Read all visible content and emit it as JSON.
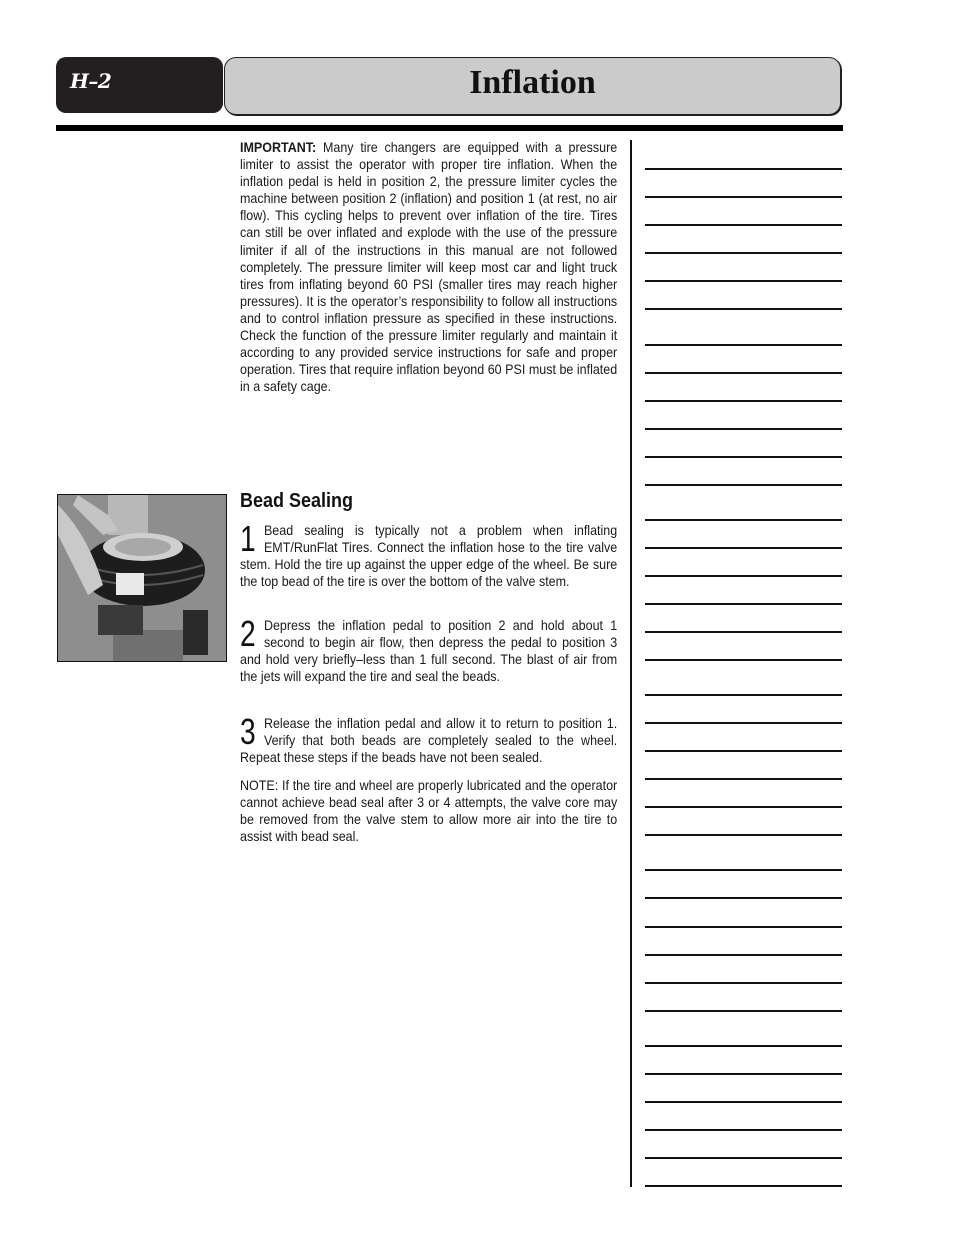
{
  "header": {
    "section_code": "H–2",
    "title": "Inflation"
  },
  "important": {
    "label": "IMPORTANT:",
    "text": " Many tire changers are equipped with a pressure limiter to assist the operator with proper tire inflation. When the inflation pedal is held in position 2, the pressure limiter cycles the machine between position 2 (inflation) and position 1 (at rest, no air flow). This cycling helps to prevent over inflation of the tire. Tires can still be over inflated and explode with the use of the pressure limiter if all of the instructions in this manual are not followed completely. The pressure limiter will keep most car and light truck tires from inflating beyond 60 PSI (smaller tires may reach higher pressures). It is the operator’s responsibility to follow all instructions and to control inflation pressure as specified in these instructions. Check the function of the pressure limiter regularly and maintain it according to any provided service instructions for safe and proper operation. Tires that require inflation beyond 60 PSI must be inflated in a safety cage."
  },
  "bead_sealing": {
    "heading": "Bead Sealing",
    "photo_alt": "Hands holding a tire and wheel against a tire changer",
    "steps": [
      {
        "number": "1",
        "text": "Bead sealing is typically not a problem when inflating EMT/RunFlat Tires. Connect the inflation hose to the tire valve stem. Hold the tire up against the upper edge of the wheel. Be sure the top bead of the tire is over the bottom of the valve stem."
      },
      {
        "number": "2",
        "text": "Depress the inflation pedal to position 2 and hold about 1 second to begin air flow, then depress the pedal to position 3 and hold very briefly–less than 1 full second. The blast of air from the jets will expand the tire and seal the beads."
      },
      {
        "number": "3",
        "text": "Release the inflation pedal and allow it to return to position 1. Verify that both beads are completely sealed to the wheel. Repeat these steps if the beads have not been sealed."
      }
    ],
    "note": "NOTE: If the tire and wheel are properly lubricated and the operator cannot achieve bead seal after 3 or 4 attempts, the valve core may be removed from the valve stem to allow more air into the tire to assist with bead seal."
  },
  "notes_column": {
    "line_count": 36
  }
}
